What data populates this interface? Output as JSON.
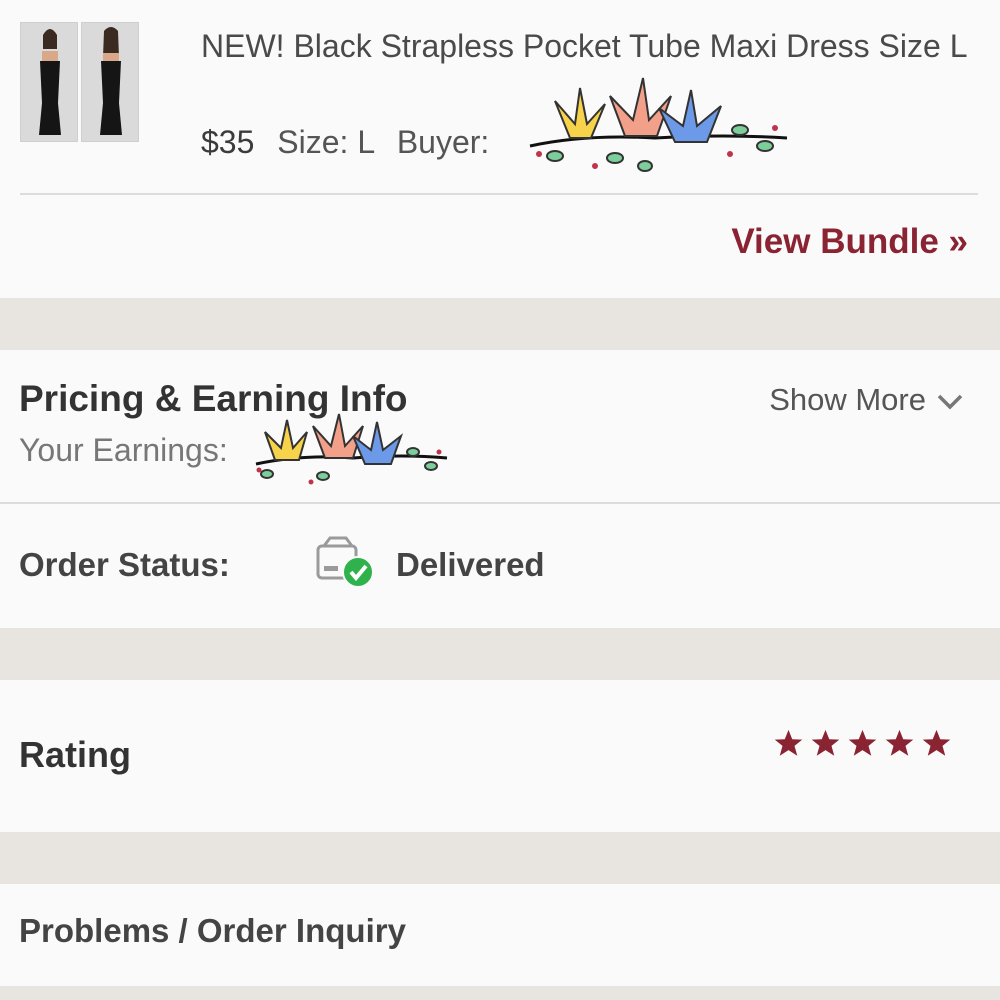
{
  "item": {
    "title": "NEW! Black Strapless Pocket Tube Maxi Dress Size L",
    "price": "$35",
    "size_text": "Size: L",
    "buyer_label": "Buyer:",
    "view_bundle": "View Bundle »",
    "thumbnails": [
      "dress-front-photo",
      "dress-back-photo"
    ]
  },
  "pricing": {
    "title": "Pricing & Earning Info",
    "earnings_label": "Your Earnings:",
    "show_more": "Show More",
    "show_more_icon": "chevron-down-icon"
  },
  "status": {
    "label": "Order Status:",
    "value": "Delivered",
    "icon": "package-delivered-icon"
  },
  "rating": {
    "label": "Rating",
    "stars": 5,
    "max_stars": 5,
    "star_color": "#8a2332"
  },
  "problems": {
    "label": "Problems / Order Inquiry"
  },
  "colors": {
    "accent": "#8a2332",
    "success": "#2fb24c",
    "background": "#e8e5e1",
    "panel": "#fafafa"
  }
}
